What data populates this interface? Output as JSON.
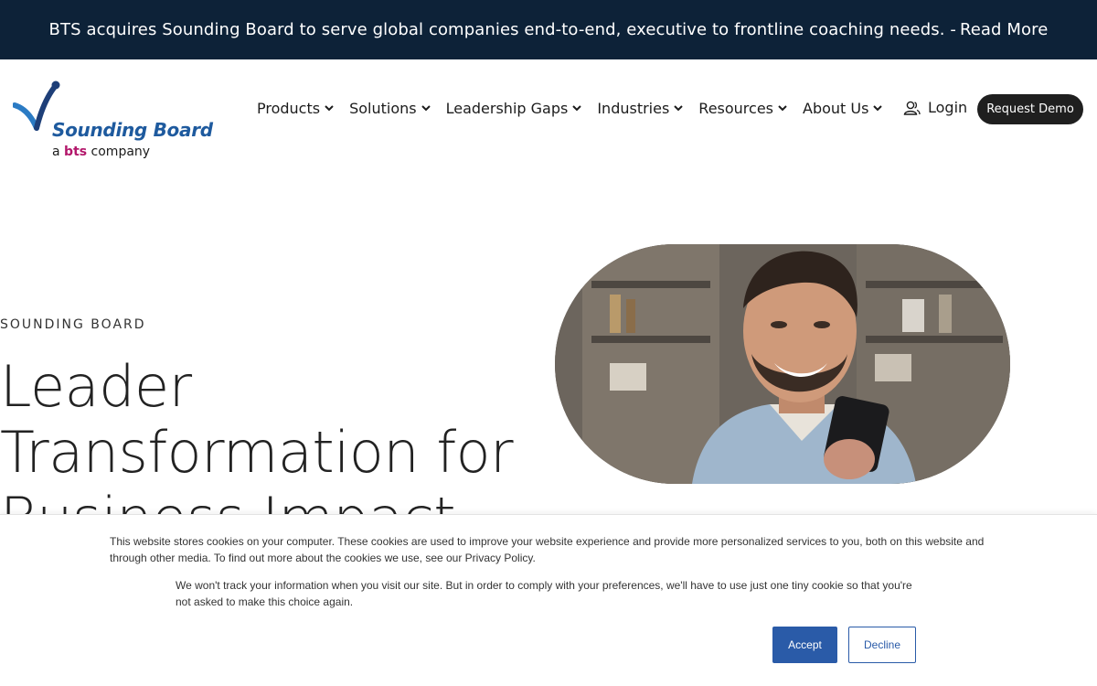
{
  "announcement": {
    "text": "BTS acquires Sounding Board to serve global companies end-to-end, executive to frontline coaching needs. -",
    "link": "Read More"
  },
  "logo": {
    "name": "Sounding Board",
    "sub_prefix": "a",
    "sub_brand": "bts",
    "sub_suffix": "company",
    "brand_color": "#1e5a9e",
    "accent_color": "#b3176b"
  },
  "nav": {
    "items": [
      {
        "label": "Products"
      },
      {
        "label": "Solutions"
      },
      {
        "label": "Leadership Gaps"
      },
      {
        "label": "Industries"
      },
      {
        "label": "Resources"
      },
      {
        "label": "About Us"
      }
    ],
    "login_label": "Login",
    "demo_label": "Request Demo"
  },
  "hero": {
    "eyebrow": "SOUNDING BOARD",
    "title_line1": "Leader",
    "title_line2": "Transformation for",
    "title_line3": "Business Impact",
    "image": "man-smiling-at-phone-photo"
  },
  "cookie": {
    "text1": "This website stores cookies on your computer. These cookies are used to improve your website experience and provide more personalized services to you, both on this website and through other media. To find out more about the cookies we use, see our Privacy Policy.",
    "text2": "We won't track your information when you visit our site. But in order to comply with your preferences, we'll have to use just one tiny cookie so that you're not asked to make this choice again.",
    "accept_label": "Accept",
    "decline_label": "Decline",
    "button_color": "#2a5ba8"
  },
  "colors": {
    "announcement_bg": "#0d2238",
    "demo_button_bg": "#1f1f1f"
  }
}
